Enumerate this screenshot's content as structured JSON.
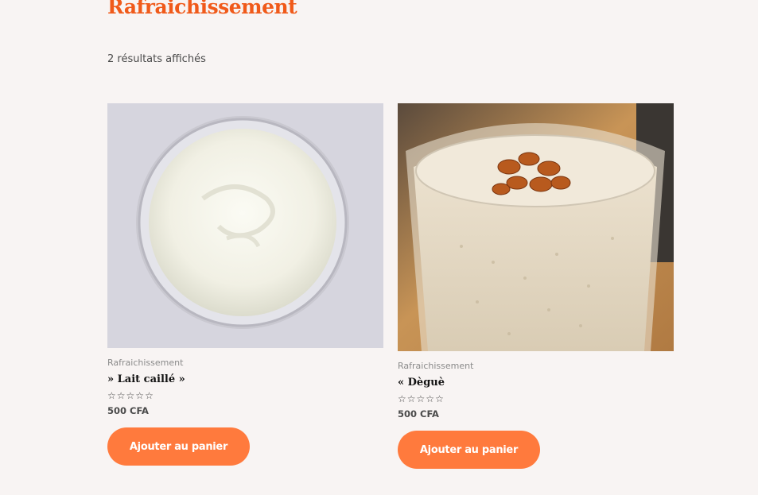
{
  "page": {
    "title": "Rafraichissement",
    "result_count": "2 résultats affichés"
  },
  "products": [
    {
      "category": "Rafraichissement",
      "name": " » Lait caillé »",
      "rating_icon": "empty-star-rating",
      "price": "500 CFA",
      "button": "Ajouter au panier",
      "image": "lait-caille-photo"
    },
    {
      "category": "Rafraichissement",
      "name": "« Dèguè",
      "rating_icon": "empty-star-rating",
      "price": "500 CFA",
      "button": "Ajouter au panier",
      "image": "degue-photo"
    }
  ],
  "colors": {
    "background": "#f8f4f3",
    "title": "#f05a1a",
    "button": "#ff7a3d"
  }
}
